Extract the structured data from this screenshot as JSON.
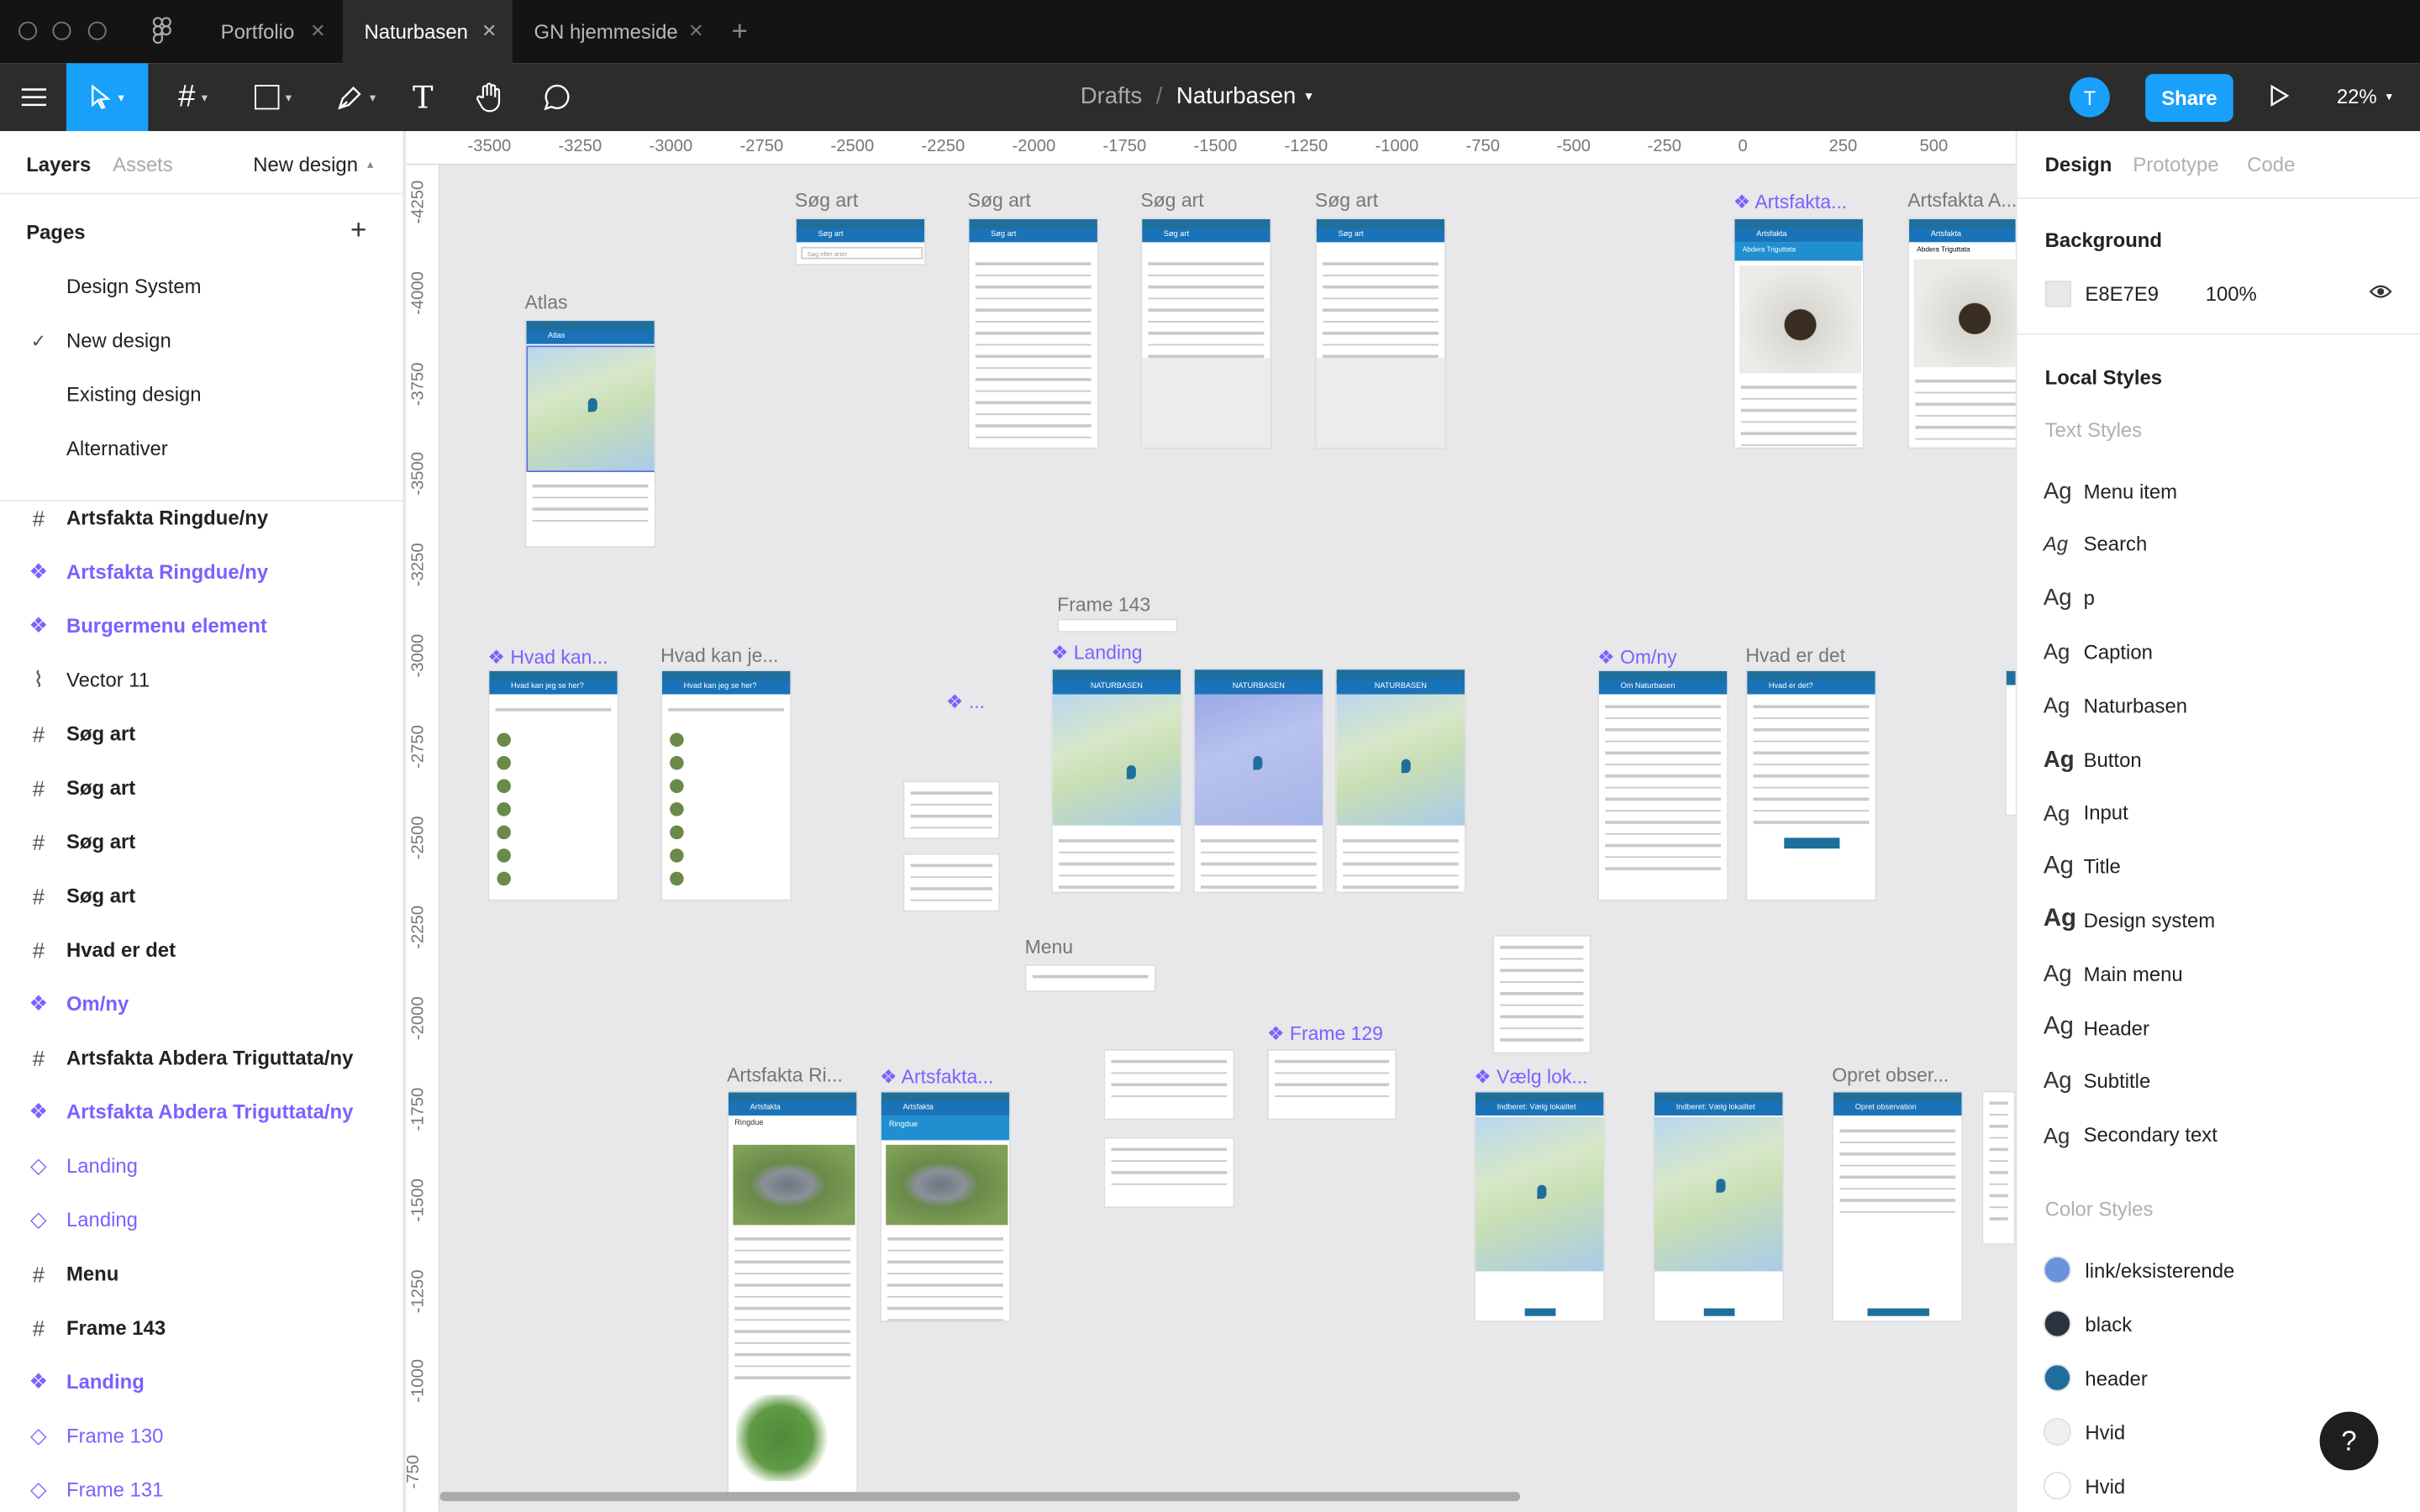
{
  "tabs": {
    "items": [
      "Portfolio",
      "Naturbasen",
      "GN hjemmeside"
    ],
    "active": "Naturbasen",
    "add_icon": "+"
  },
  "toolbar": {
    "breadcrumb_root": "Drafts",
    "breadcrumb_sep": "/",
    "file_name": "Naturbasen",
    "avatar_initial": "T",
    "share_label": "Share",
    "zoom": "22%",
    "active_tool": "move",
    "accent": "#18a0fb"
  },
  "left_panel": {
    "tabs": [
      "Layers",
      "Assets"
    ],
    "page_selector": "New design",
    "pages_heading": "Pages",
    "pages": [
      "Design System",
      "New design",
      "Existing design",
      "Alternativer"
    ],
    "selected_page": "New design",
    "layers": [
      {
        "label": "Artsfakta Ringdue/ny",
        "icon": "frame-icon",
        "style": "bold"
      },
      {
        "label": "Artsfakta Ringdue/ny",
        "icon": "component-icon",
        "style": "purple-bold"
      },
      {
        "label": "Burgermenu element",
        "icon": "component-icon",
        "style": "purple-bold"
      },
      {
        "label": "Vector 11",
        "icon": "vector-icon",
        "style": "normal"
      },
      {
        "label": "Søg art",
        "icon": "frame-icon",
        "style": "bold"
      },
      {
        "label": "Søg art",
        "icon": "frame-icon",
        "style": "bold"
      },
      {
        "label": "Søg art",
        "icon": "frame-icon",
        "style": "bold"
      },
      {
        "label": "Søg art",
        "icon": "frame-icon",
        "style": "bold"
      },
      {
        "label": "Hvad er det",
        "icon": "frame-icon",
        "style": "bold"
      },
      {
        "label": "Om/ny",
        "icon": "component-icon",
        "style": "purple-bold"
      },
      {
        "label": "Artsfakta Abdera Triguttata/ny",
        "icon": "frame-icon",
        "style": "bold"
      },
      {
        "label": "Artsfakta Abdera Triguttata/ny",
        "icon": "component-icon",
        "style": "purple-bold"
      },
      {
        "label": "Landing",
        "icon": "instance-icon",
        "style": "purple"
      },
      {
        "label": "Landing",
        "icon": "instance-icon",
        "style": "purple"
      },
      {
        "label": "Menu",
        "icon": "frame-icon",
        "style": "bold"
      },
      {
        "label": "Frame 143",
        "icon": "frame-icon",
        "style": "bold"
      },
      {
        "label": "Landing",
        "icon": "component-icon",
        "style": "purple-bold"
      },
      {
        "label": "Frame 130",
        "icon": "instance-icon",
        "style": "purple"
      },
      {
        "label": "Frame 131",
        "icon": "instance-icon",
        "style": "purple"
      }
    ]
  },
  "rulers": {
    "top": [
      "-3500",
      "-3250",
      "-3000",
      "-2750",
      "-2500",
      "-2250",
      "-2000",
      "-1750",
      "-1500",
      "-1250",
      "-1000",
      "-750",
      "-500",
      "-250",
      "0",
      "250",
      "500"
    ],
    "left": [
      "-4250",
      "-4000",
      "-3750",
      "-3500",
      "-3250",
      "-3000",
      "-2750",
      "-2500",
      "-2250",
      "-2000",
      "-1750",
      "-1500",
      "-1250",
      "-1000",
      "-750"
    ]
  },
  "canvas": {
    "frame_labels": {
      "sog1": "Søg art",
      "sog2": "Søg art",
      "sog3": "Søg art",
      "sog4": "Søg art",
      "artsfakta_comp": "Artsfakta...",
      "artsfakta_a": "Artsfakta A...",
      "atlas": "Atlas",
      "frame143": "Frame 143",
      "landing": "Landing",
      "hvad_kan1": "Hvad kan...",
      "hvad_kan2": "Hvad kan je...",
      "dots": "...",
      "om_ny": "Om/ny",
      "hvad_er_det": "Hvad er det",
      "menu": "Menu",
      "frame129": "Frame 129",
      "artsfakta_ri": "Artsfakta Ri...",
      "artsfakta_comp2": "Artsfakta...",
      "vaelg_lok": "Vælg lok...",
      "opret_obser": "Opret obser..."
    },
    "app_headers": {
      "atlas": "Atlas",
      "sog": "Søg art",
      "artsfakta": "Artsfakta",
      "naturbasen": "NATURBASEN",
      "hvad_kan": "Hvad kan jeg se her?",
      "om": "Om Naturbasen",
      "hvad_er_det": "Hvad er det?",
      "ringdue": "Ringdue",
      "abdera": "Abdera Triguttata",
      "indberet": "Indberet: Vælg lokalitet",
      "opret": "Opret observation",
      "search_placeholder": "Søg efter arter"
    }
  },
  "right_panel": {
    "tabs": [
      "Design",
      "Prototype",
      "Code"
    ],
    "active_tab": "Design",
    "background_heading": "Background",
    "background_hex": "E8E7E9",
    "background_opacity": "100%",
    "background_color": "#e8e7e9",
    "local_styles_heading": "Local Styles",
    "text_styles_heading": "Text Styles",
    "text_styles": [
      "Menu item",
      "Search",
      "p",
      "Caption",
      "Naturbasen",
      "Button",
      "Input",
      "Title",
      "Design system",
      "Main menu",
      "Header",
      "Subtitle",
      "Secondary text"
    ],
    "ag_glyph": "Ag",
    "color_styles_heading": "Color Styles",
    "color_styles": [
      {
        "name": "link/eksisterende",
        "color": "#6a93dd"
      },
      {
        "name": "black",
        "color": "#2b3240"
      },
      {
        "name": "header",
        "color": "#1f6f9c"
      },
      {
        "name": "Hvid",
        "color": "#f0f0f0"
      },
      {
        "name": "Hvid",
        "color": "#ffffff"
      }
    ],
    "help_label": "?"
  }
}
